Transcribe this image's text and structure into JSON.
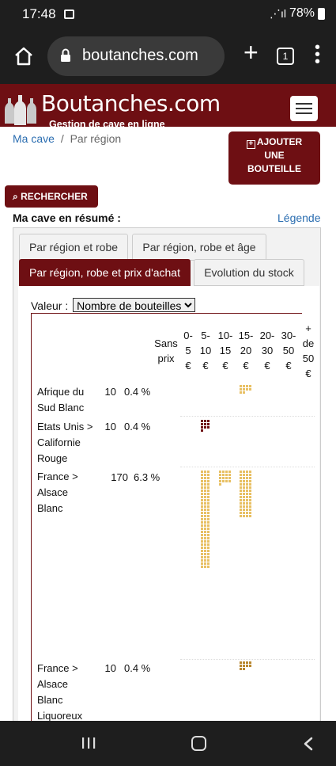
{
  "status": {
    "time": "17:48",
    "battery": "78%"
  },
  "browser": {
    "url": "boutanches.com",
    "tab_count": "1"
  },
  "site": {
    "logo_name": "Boutanches.com",
    "tagline": "Gestion de cave en ligne"
  },
  "breadcrumb": {
    "home": "Ma cave",
    "separator": "/",
    "current": "Par région"
  },
  "buttons": {
    "add_line1": "AJOUTER",
    "add_line2": "UNE",
    "add_line3": "BOUTEILLE",
    "search": "RECHERCHER"
  },
  "summary": {
    "title": "Ma cave en résumé :",
    "legend": "Légende"
  },
  "tabs": [
    {
      "label": "Par région et robe"
    },
    {
      "label": "Par région, robe et âge"
    },
    {
      "label": "Par région, robe et prix d'achat"
    },
    {
      "label": "Evolution du stock"
    }
  ],
  "valeur": {
    "label": "Valeur :",
    "selected": "Nombre de bouteilles"
  },
  "columns": [
    {
      "l1": "Sans",
      "l2": "prix"
    },
    {
      "l1": "0-",
      "l2": "5",
      "l3": "€"
    },
    {
      "l1": "5-",
      "l2": "10",
      "l3": "€"
    },
    {
      "l1": "10-",
      "l2": "15",
      "l3": "€"
    },
    {
      "l1": "15-",
      "l2": "20",
      "l3": "€"
    },
    {
      "l1": "20-",
      "l2": "30",
      "l3": "€"
    },
    {
      "l1": "30-",
      "l2": "50",
      "l3": "€"
    },
    {
      "l1": "+",
      "l2": "de",
      "l3": "50",
      "l4": "€"
    }
  ],
  "rows": [
    {
      "l1": "Afrique du",
      "l2": "Sud Blanc",
      "count": "10",
      "pct": "0.4 %",
      "color": "#e8c064",
      "bucket": "15-20 €",
      "bottles": 10
    },
    {
      "l1": "Etats Unis >",
      "l2": "Californie",
      "l3": "Rouge",
      "count": "10",
      "pct": "0.4 %",
      "color": "#6e0f13",
      "bucket": "5-10 €",
      "bottles": 10
    },
    {
      "l1": "France >",
      "l2": "Alsace",
      "l3": "Blanc",
      "count": "170",
      "pct": "6.3 %",
      "color": "#e8c064",
      "buckets": [
        {
          "range": "5-10 €",
          "bottles": 93
        },
        {
          "range": "10-15 €",
          "bottles": 17
        },
        {
          "range": "15-20 €",
          "bottles": 60
        }
      ]
    },
    {
      "l1": "France >",
      "l2": "Alsace",
      "l3": "Blanc",
      "l4": "Liquoreux",
      "count": "10",
      "pct": "0.4 %",
      "color": "#b8862e",
      "bucket": "15-20 €",
      "bottles": 10
    }
  ]
}
